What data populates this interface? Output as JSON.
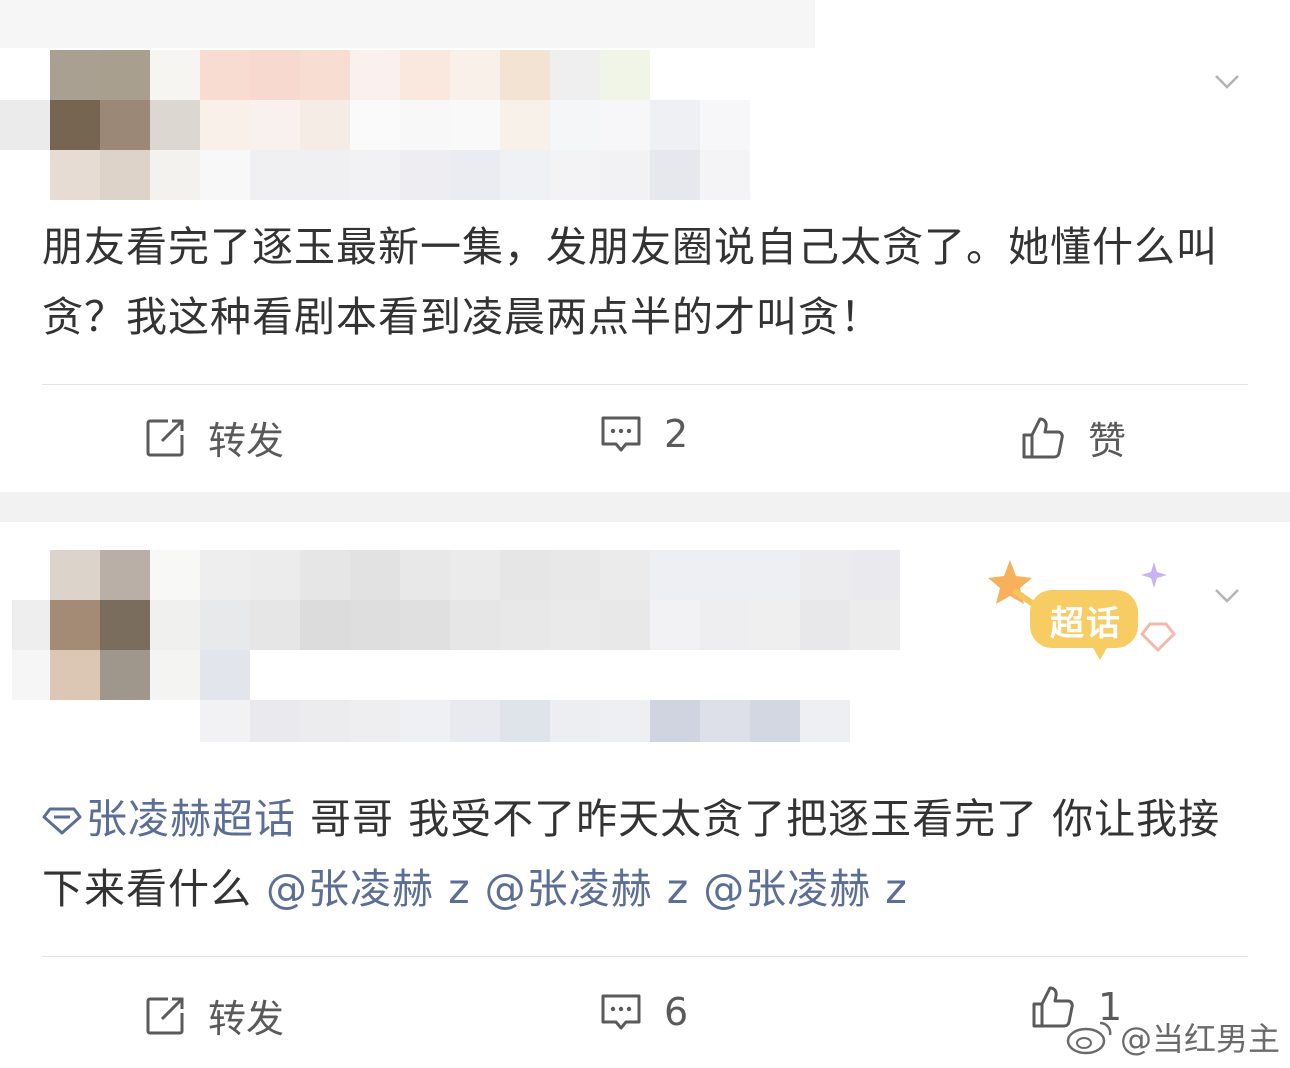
{
  "posts": [
    {
      "text": "朋友看完了逐玉最新一集，发朋友圈说自己太贪了。她懂什么叫贪？我这种看剧本看到凌晨两点半的才叫贪！",
      "actions": {
        "repost_label": "转发",
        "comment_count": "2",
        "like_label": "赞"
      }
    },
    {
      "topic_tag": "张凌赫超话",
      "text": " 哥哥 我受不了昨天太贪了把逐玉看完了 你让我接下来看什么 ",
      "mentions": [
        "@张凌赫 z",
        "@张凌赫 z",
        "@张凌赫 z"
      ],
      "badge_label": "超话",
      "actions": {
        "repost_label": "转发",
        "comment_count": "6",
        "like_count": "1"
      }
    }
  ],
  "watermark": "@当红男主",
  "colors": {
    "link": "#5b6e96",
    "icon": "#5a5a5a",
    "badge_yellow": "#f6c65a",
    "separator": "#f2f2f2"
  }
}
